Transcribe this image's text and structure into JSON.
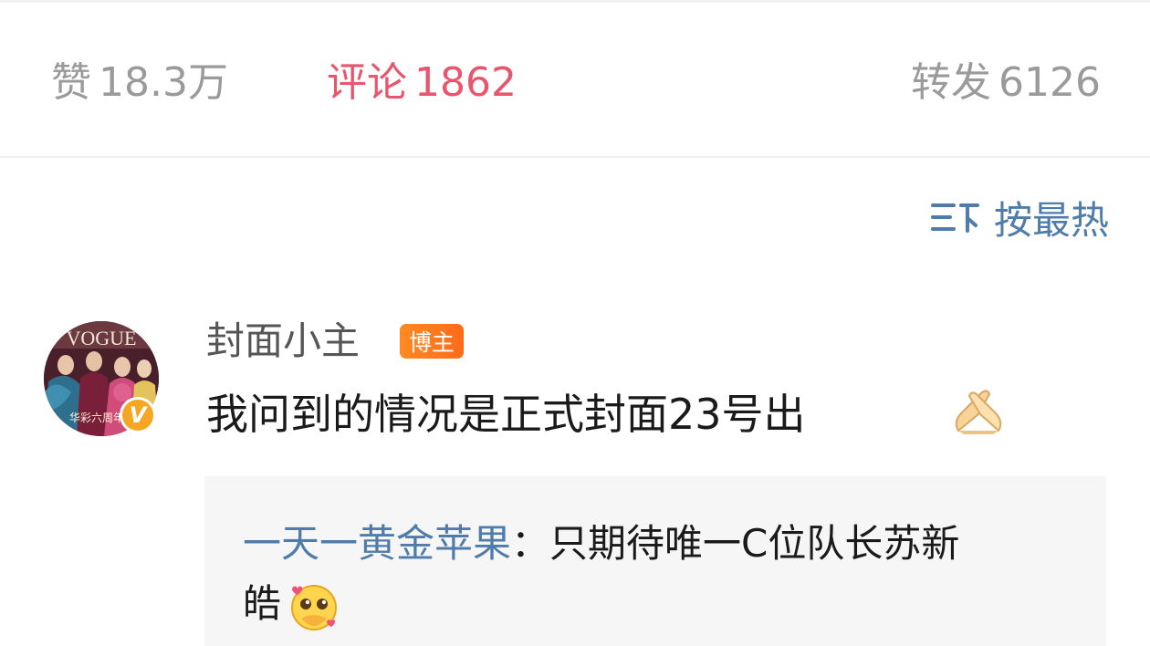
{
  "tabs": {
    "likes": {
      "label": "赞",
      "count": "18.3万"
    },
    "comments": {
      "label": "评论",
      "count": "1862"
    },
    "reposts": {
      "label": "转发",
      "count": "6126"
    }
  },
  "sort": {
    "label": "按最热",
    "icon": "sort-icon"
  },
  "comment": {
    "avatar_text": "VOGUE",
    "avatar_caption": "华彩六周年",
    "username": "封面小主",
    "badge": "博主",
    "verify_mark": "V",
    "text": "我问到的情况是正式封面23号出",
    "emoji": "folded-hands-emoji"
  },
  "reply": {
    "author": "一天一黄金苹果",
    "separator": "：",
    "text_line1": "只期待唯一C位队长苏新",
    "text_line2": "皓",
    "emoji": "pleading-face-hearts-emoji"
  },
  "colors": {
    "accent": "#e8556d",
    "link": "#4f7cab",
    "muted": "#9a9a9a",
    "badge": "#ff7a1e",
    "verify": "#f5a623"
  }
}
